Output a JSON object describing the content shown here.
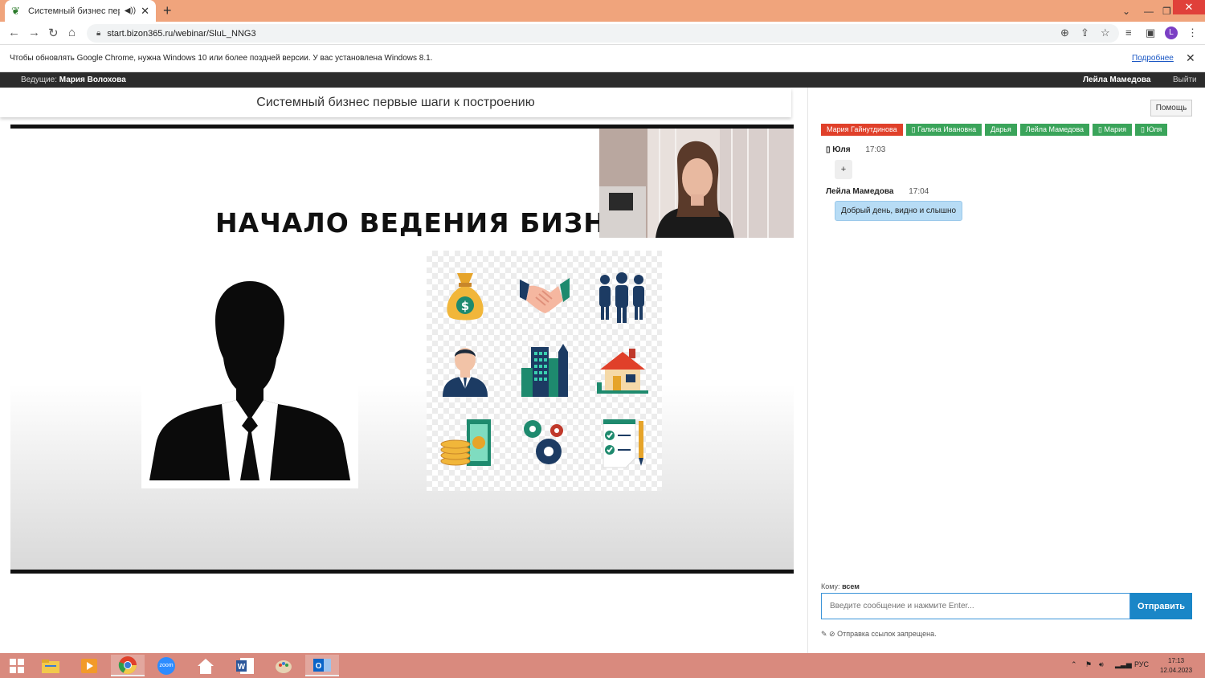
{
  "browser": {
    "tab_title": "Системный бизнес первые",
    "address": "start.bizon365.ru/webinar/SluL_NNG3",
    "profile_initial": "L",
    "infobar_message": "Чтобы обновлять Google Chrome, нужна Windows 10 или более поздней версии. У вас установлена Windows 8.1.",
    "infobar_link": "Подробнее"
  },
  "host_bar": {
    "host_label": "Ведущие:",
    "host_name": "Мария Волохова",
    "current_user": "Лейла Мамедова",
    "logout": "Выйти"
  },
  "webinar": {
    "title": "Системный бизнес первые шаги к построению",
    "slide_heading": "НАЧАЛО ВЕДЕНИЯ БИЗНЕСА"
  },
  "chat": {
    "help_label": "Помощь",
    "participants": [
      {
        "name": "Мария Гайнутдинова",
        "color": "#e0402a"
      },
      {
        "name": "▯ Галина Ивановна",
        "color": "#3aa45a"
      },
      {
        "name": "Дарья",
        "color": "#3aa45a"
      },
      {
        "name": "Лейла Мамедова",
        "color": "#3aa45a"
      },
      {
        "name": "▯ Мария",
        "color": "#3aa45a"
      },
      {
        "name": "▯ Юля",
        "color": "#3aa45a"
      }
    ],
    "messages": [
      {
        "author": "▯ Юля",
        "time": "17:03",
        "text": "+"
      },
      {
        "author": "Лейла Мамедова",
        "time": "17:04",
        "text": "Добрый день, видно и слышно"
      }
    ],
    "recipient_label": "Кому:",
    "recipient": "всем",
    "input_placeholder": "Введите сообщение и нажмите Enter...",
    "send_label": "Отправить",
    "links_note": "✎ ⊘ Отправка ссылок запрещена."
  },
  "taskbar": {
    "language": "РУС",
    "time": "17:13",
    "date": "12.04.2023",
    "zoom_label": "zoom"
  }
}
